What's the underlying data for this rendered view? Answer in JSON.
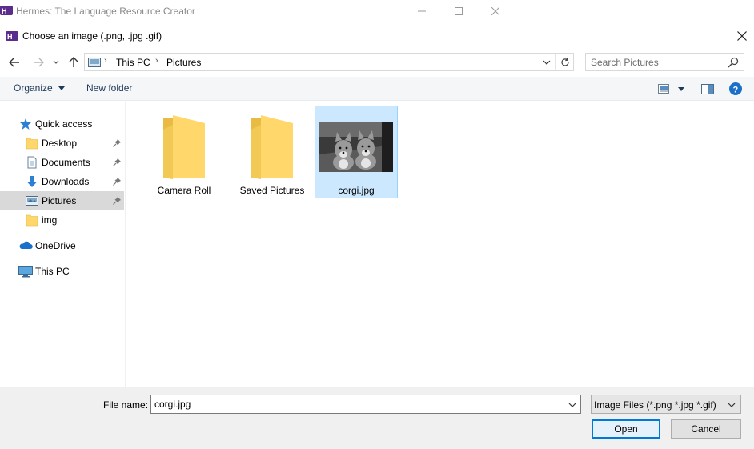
{
  "parent_window": {
    "title": "Hermes: The Language Resource Creator",
    "controls": [
      "minimize",
      "maximize",
      "close"
    ]
  },
  "dialog": {
    "title": "Choose an image (.png, .jpg .gif)",
    "close_icon": "close-icon"
  },
  "navigation": {
    "back_icon": "back-arrow-icon",
    "forward_icon": "forward-arrow-icon",
    "recent_icon": "chevron-down-icon",
    "up_icon": "up-arrow-icon"
  },
  "address": {
    "crumbs": [
      "This PC",
      "Pictures"
    ]
  },
  "search": {
    "placeholder": "Search Pictures"
  },
  "toolbar": {
    "organize_label": "Organize",
    "new_folder_label": "New folder"
  },
  "sidebar": {
    "items": [
      {
        "label": "Quick access",
        "icon": "star-icon"
      },
      {
        "label": "Desktop",
        "icon": "folder-icon",
        "pinned": true
      },
      {
        "label": "Documents",
        "icon": "documents-icon",
        "pinned": true
      },
      {
        "label": "Downloads",
        "icon": "download-icon",
        "pinned": true
      },
      {
        "label": "Pictures",
        "icon": "pictures-icon",
        "pinned": true,
        "selected": true
      },
      {
        "label": "img",
        "icon": "folder-icon"
      },
      {
        "label": "OneDrive",
        "icon": "cloud-icon"
      },
      {
        "label": "This PC",
        "icon": "computer-icon"
      }
    ]
  },
  "files": [
    {
      "name": "Camera Roll",
      "type": "folder"
    },
    {
      "name": "Saved Pictures",
      "type": "folder"
    },
    {
      "name": "corgi.jpg",
      "type": "image",
      "selected": true
    }
  ],
  "footer": {
    "file_name_label": "File name:",
    "file_name_value": "corgi.jpg",
    "file_type_value": "Image Files (*.png *.jpg *.gif)",
    "open_label": "Open",
    "cancel_label": "Cancel"
  },
  "colors": {
    "selection_bg": "#cce8ff",
    "selection_border": "#99d1ff",
    "accent": "#0078d7",
    "folder": "#ffd76a"
  }
}
